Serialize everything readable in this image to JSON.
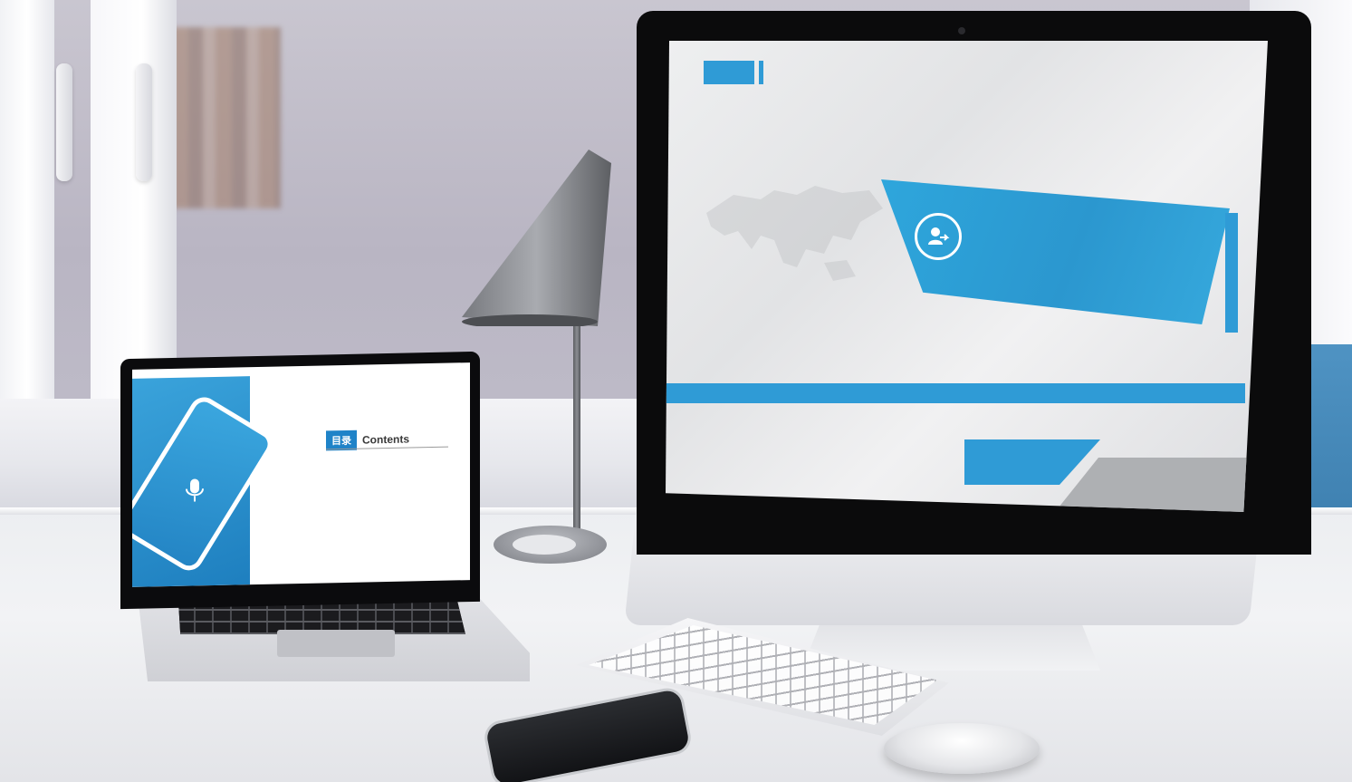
{
  "laptop": {
    "slide_chip": "目录",
    "slide_heading": "Contents"
  },
  "icons": [
    "desk-lamp-icon",
    "microphone-icon",
    "user-transfer-icon",
    "world-map-icon"
  ],
  "colors": {
    "accent_blue": "#2f9bd6",
    "desk_white": "#eceef1",
    "monitor_bezel": "#0b0b0c"
  }
}
